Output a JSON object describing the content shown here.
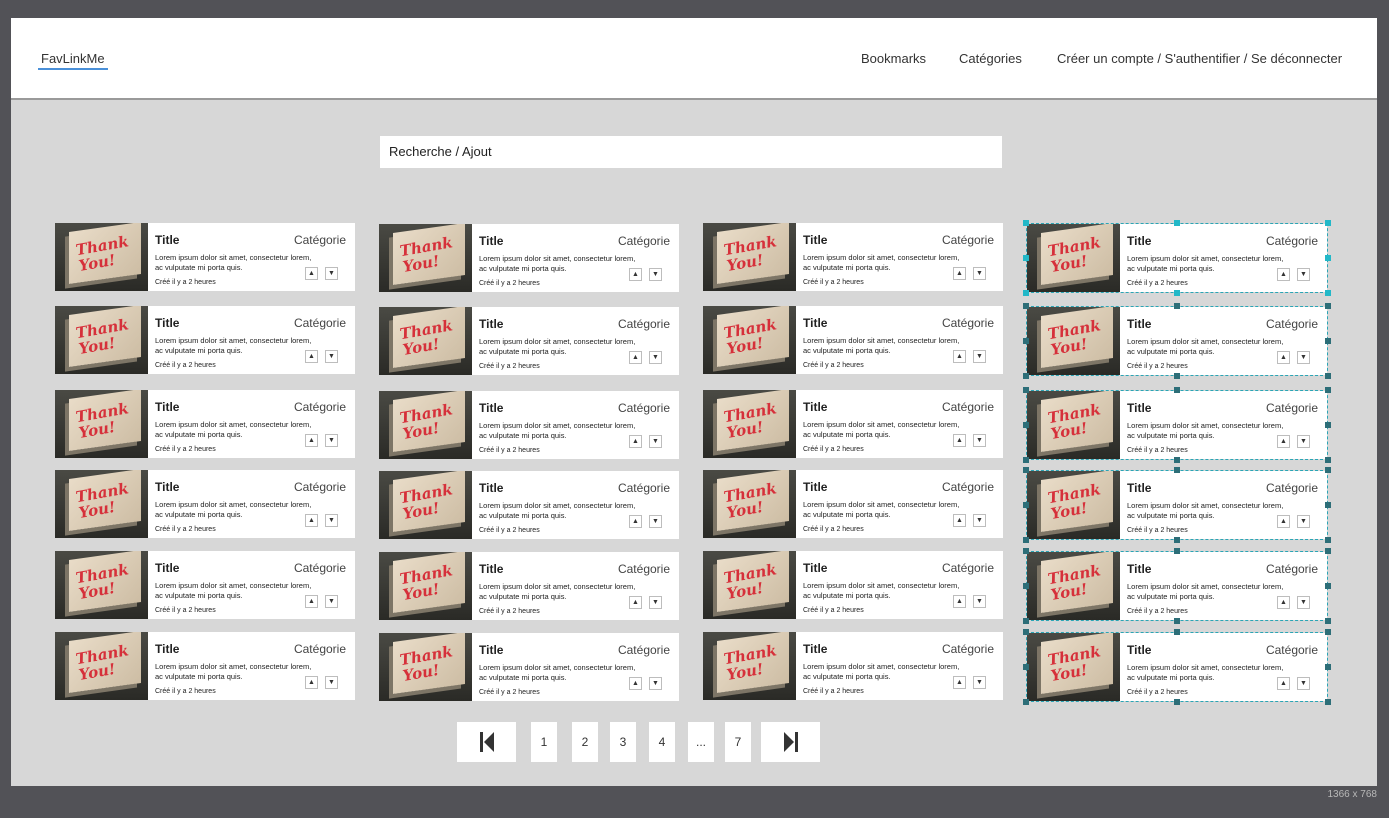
{
  "header": {
    "brand": "FavLinkMe",
    "nav": [
      "Bookmarks",
      "Catégories",
      "Créer un compte / S'authentifier / Se déconnecter"
    ]
  },
  "search": {
    "label": "Recherche / Ajout"
  },
  "card_template": {
    "title": "Title",
    "category": "Catégorie",
    "description": "Lorem ipsum dolor sit amet, consectetur lorem, ac vulputate mi porta quis.",
    "date": "Créé il y a 2 heures",
    "thumbnail_text": "Thank You!"
  },
  "grid": {
    "columns": 4,
    "rows": 6,
    "selected_column": 4
  },
  "pagination": {
    "pages": [
      "1",
      "2",
      "3",
      "4",
      "...",
      "7"
    ],
    "first_icon": "first-page-icon",
    "last_icon": "last-page-icon"
  },
  "resolution_label": "1366 x 768",
  "colors": {
    "canvas": "#d7d7d7",
    "frame": "#525257",
    "selection": "#2aa5b5",
    "accent": "#4a90d9"
  }
}
